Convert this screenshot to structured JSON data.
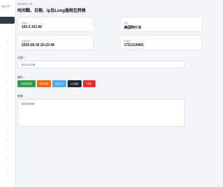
{
  "sidebar": {
    "brand": "在线工具"
  },
  "header": {
    "breadcrumb": "时间转换工具",
    "title": "时间戳、日期、Ip及Long值相互转换"
  },
  "cards": [
    {
      "label": "IP地址",
      "value": "192.0.101.66"
    },
    {
      "label": "位置",
      "value": "美国阿什本"
    },
    {
      "label": "当前时间",
      "value": "2025-06-30 20:22:48"
    },
    {
      "label": "时间戳",
      "value": "1751314960"
    }
  ],
  "form": {
    "input_label": "内容",
    "input_value": "192.0.101.66",
    "action_label": "操作",
    "buttons": [
      "时间转日期",
      "转时间戳",
      "Ip转Long",
      "Long转Ip",
      "清空"
    ],
    "result_label": "结果",
    "result_value": "3221251650"
  }
}
